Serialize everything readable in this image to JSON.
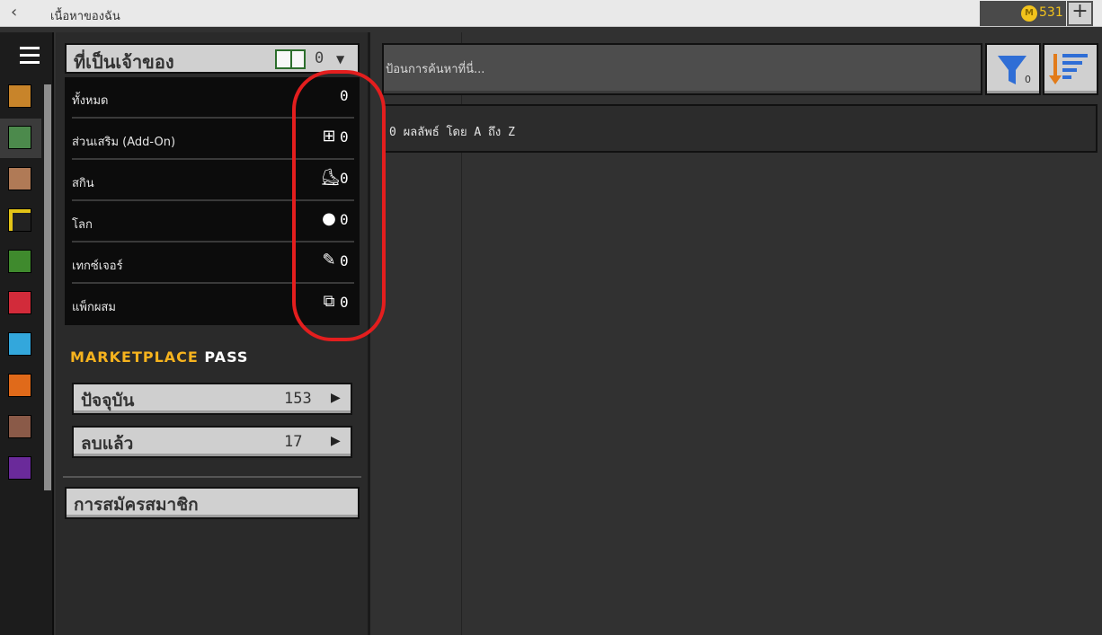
{
  "titlebar": {
    "back_icon": "chevron-left-icon",
    "title": "เนื้อหาของฉัน",
    "coins": "531",
    "add_coins_label": "+"
  },
  "rail": {
    "menu_icon": "hamburger-menu-icon",
    "items": [
      {
        "icon": "skin-pack-icon",
        "color": "#c8842a"
      },
      {
        "icon": "library-icon",
        "color": "#4c8a4c",
        "active": true
      },
      {
        "icon": "villager-icon",
        "color": "#b07a56"
      },
      {
        "icon": "firefly-icon",
        "color": "#e3c417"
      },
      {
        "icon": "sapling-icon",
        "color": "#3f8a2d"
      },
      {
        "icon": "heart-icon",
        "color": "#d22b3a"
      },
      {
        "icon": "creeper-face-icon",
        "color": "#33a7dc"
      },
      {
        "icon": "fire-icon",
        "color": "#e06a1a"
      },
      {
        "icon": "character-heart-icon",
        "color": "#8a5a48"
      },
      {
        "icon": "portal-icon",
        "color": "#6a2a9a"
      }
    ]
  },
  "owner": {
    "label": "ที่เป็นเจ้าของ",
    "book_icon": "book-icon",
    "count": "0",
    "caret_icon": "chevron-down-icon"
  },
  "filters": [
    {
      "label": "ทั้งหมด",
      "icon": "",
      "count": "0"
    },
    {
      "label": "ส่วนเสริม (Add-On)",
      "icon": "add-on-icon",
      "count": "0"
    },
    {
      "label": "สกิน",
      "icon": "skin-icon",
      "count": "0"
    },
    {
      "label": "โลก",
      "icon": "world-icon",
      "count": "0"
    },
    {
      "label": "เทกซ์เจอร์",
      "icon": "texture-brush-icon",
      "count": "0"
    },
    {
      "label": "แพ็กผสม",
      "icon": "mashup-icon",
      "count": "0"
    }
  ],
  "marketplace_pass": {
    "title_a": "MARKETPLACE",
    "title_b": "PASS",
    "title_a_color": "#f6b31e",
    "current": {
      "label": "ปัจจุบัน",
      "count": "153"
    },
    "removed": {
      "label": "ลบแล้ว",
      "count": "17"
    }
  },
  "subscription_label": "การสมัครสมาชิก",
  "search": {
    "placeholder": "ป้อนการค้นหาที่นี่..."
  },
  "filter_button": {
    "icon": "funnel-icon",
    "badge": "0"
  },
  "sort_button": {
    "icon": "sort-descending-icon"
  },
  "results": {
    "text": "0 ผลลัพธ์ โดย A ถึง Z"
  },
  "annotation": {
    "color": "#e31e1e"
  }
}
